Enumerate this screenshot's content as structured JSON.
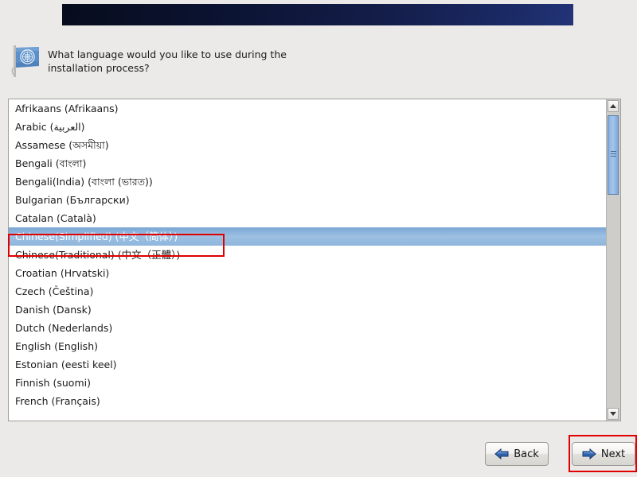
{
  "window": {
    "background_color": "#ebeae8",
    "banner_color_start": "#070c1c",
    "banner_color_end": "#223477"
  },
  "prompt": {
    "icon": "un-flag-icon",
    "text": "What language would you like to use during the installation process?"
  },
  "language_list": {
    "selected_index": 7,
    "items": [
      "Afrikaans (Afrikaans)",
      "Arabic (العربية)",
      "Assamese (অসমীয়া)",
      "Bengali (বাংলা)",
      "Bengali(India) (বাংলা (ভারত))",
      "Bulgarian (Български)",
      "Catalan (Català)",
      "Chinese(Simplified) (中文（简体）)",
      "Chinese(Traditional) (中文（正體）)",
      "Croatian (Hrvatski)",
      "Czech (Čeština)",
      "Danish (Dansk)",
      "Dutch (Nederlands)",
      "English (English)",
      "Estonian (eesti keel)",
      "Finnish (suomi)",
      "French (Français)"
    ]
  },
  "scrollbar": {
    "up_arrow": "chevron-up-icon",
    "down_arrow": "chevron-down-icon",
    "thumb_color": "#8fb6dd"
  },
  "buttons": {
    "back": {
      "label": "Back",
      "icon": "arrow-left-icon"
    },
    "next": {
      "label": "Next",
      "icon": "arrow-right-icon"
    }
  },
  "annotations": {
    "highlight_color": "#e00000",
    "boxes": [
      "selected-language-row",
      "next-button"
    ]
  }
}
